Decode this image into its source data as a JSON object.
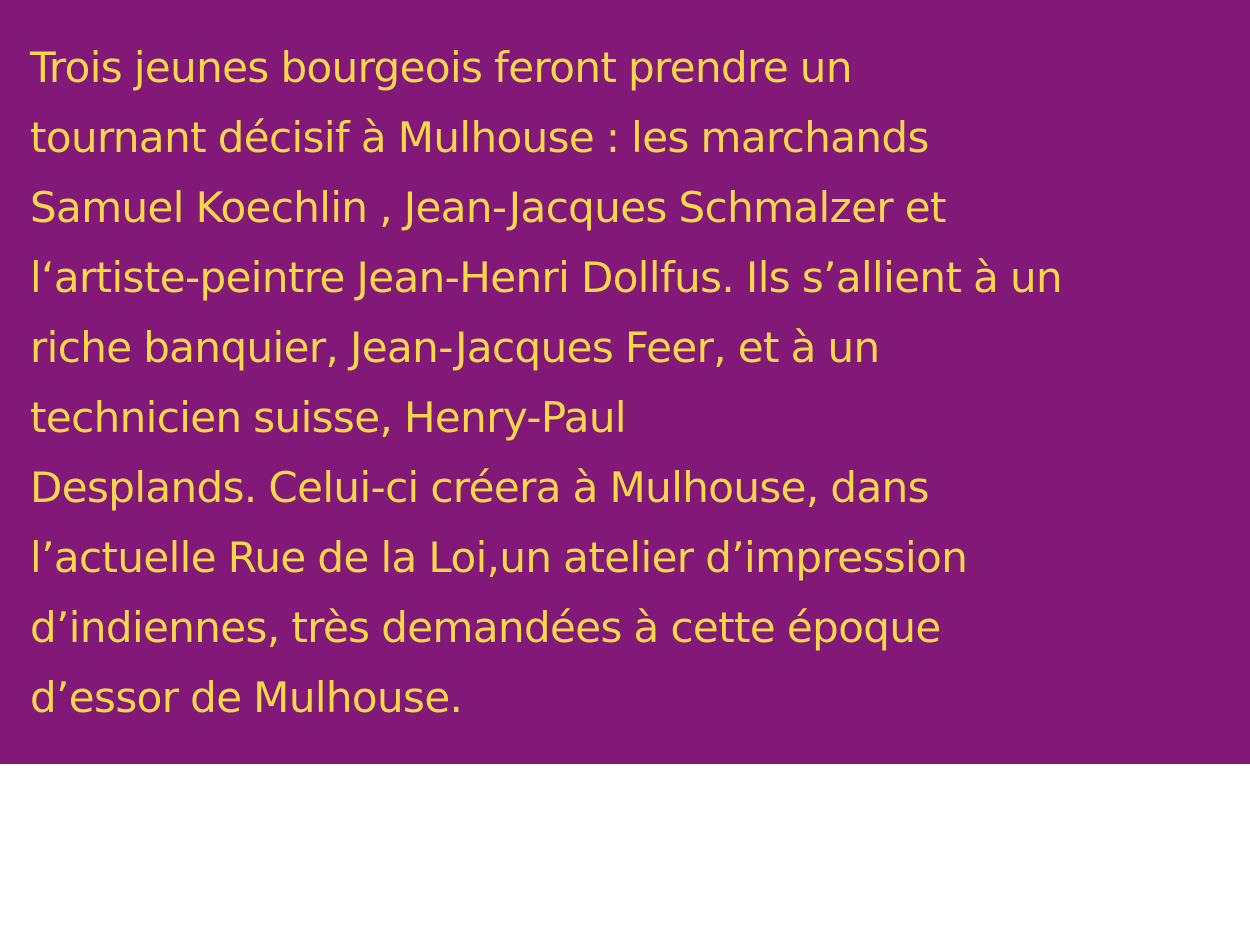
{
  "article": {
    "background_color": "#821877",
    "text_color": "#f5d84a",
    "lines": [
      "Trois jeunes bourgeois feront prendre un",
      "tournant décisif à Mulhouse : les marchands",
      "Samuel Koechlin , Jean-Jacques Schmalzer et",
      "l‘artiste-peintre Jean-Henri Dollfus. Ils s’allient à un",
      "riche banquier, Jean-Jacques Feer, et à un",
      "technicien suisse, Henry-Paul",
      "Desplands. Celui-ci créera à Mulhouse, dans",
      "l’actuelle Rue de la Loi,un atelier d’impression",
      "d’indiennes, très demandées à cette époque",
      "d’essor de Mulhouse."
    ]
  }
}
